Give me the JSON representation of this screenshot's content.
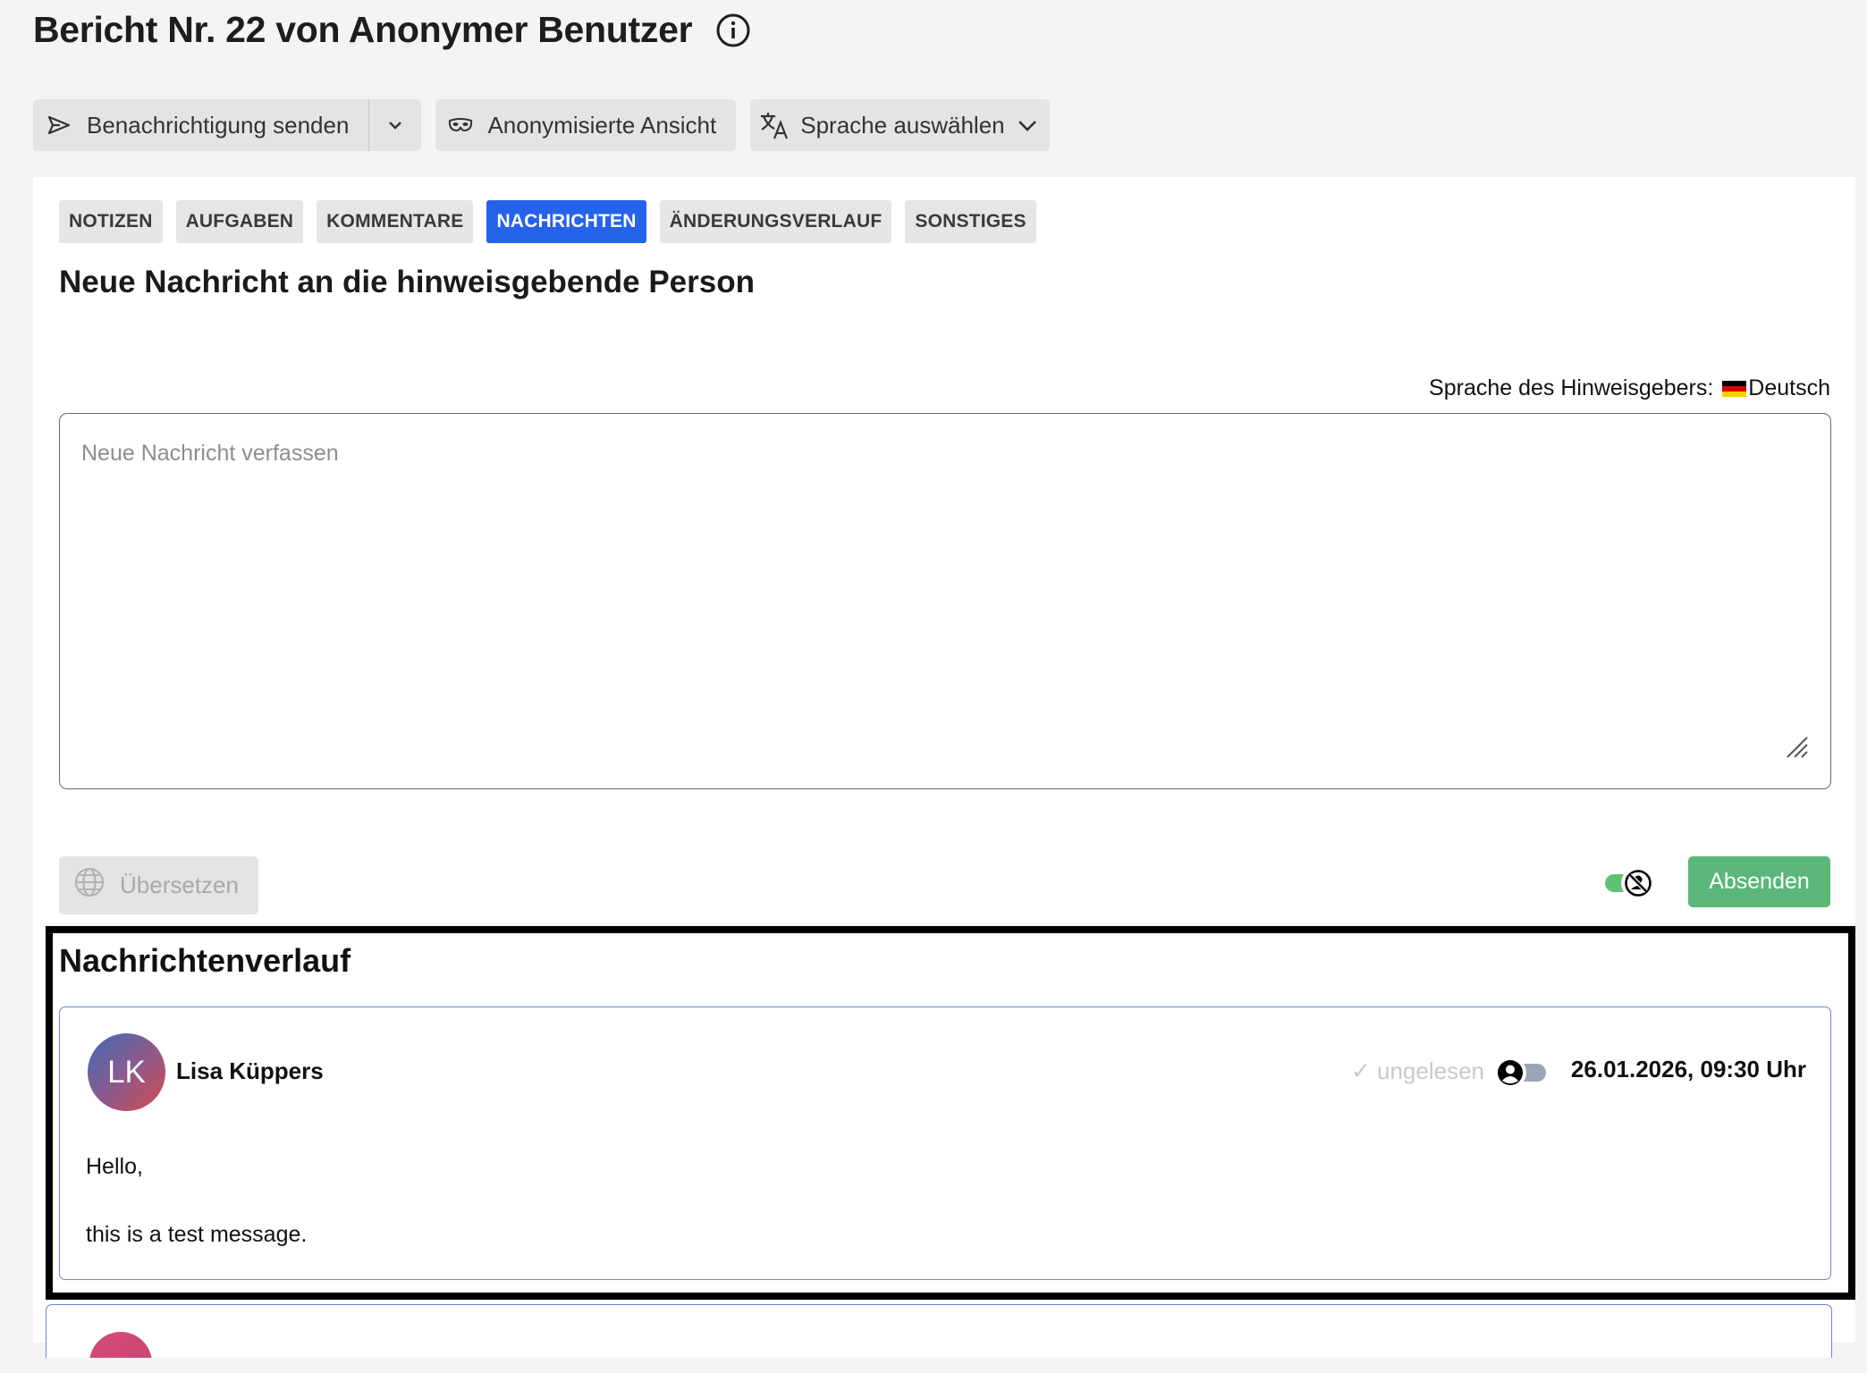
{
  "page": {
    "title": "Bericht Nr. 22 von Anonymer Benutzer"
  },
  "toolbar": {
    "notify_label": "Benachrichtigung senden",
    "anonymized_label": "Anonymisierte Ansicht",
    "language_label": "Sprache auswählen"
  },
  "tabs": [
    {
      "label": "NOTIZEN",
      "active": false
    },
    {
      "label": "AUFGABEN",
      "active": false
    },
    {
      "label": "KOMMENTARE",
      "active": false
    },
    {
      "label": "NACHRICHTEN",
      "active": true
    },
    {
      "label": "ÄNDERUNGSVERLAUF",
      "active": false
    },
    {
      "label": "SONSTIGES",
      "active": false
    }
  ],
  "compose": {
    "title": "Neue Nachricht an die hinweisgebende Person",
    "reporter_language_label": "Sprache des Hinweisgebers:",
    "reporter_language_value": "Deutsch",
    "placeholder": "Neue Nachricht verfassen",
    "value": "",
    "translate_label": "Übersetzen",
    "send_label": "Absenden"
  },
  "history": {
    "title": "Nachrichtenverlauf",
    "messages": [
      {
        "initials": "LK",
        "author": "Lisa Küppers",
        "read_status": "✓ ungelesen",
        "timestamp": "26.01.2026, 09:30 Uhr",
        "line1": "Hello,",
        "line2": "this is a test message."
      }
    ]
  },
  "colors": {
    "accent": "#2563eb",
    "send_button": "#5ab779",
    "toggle_on": "#5ec176",
    "card_border": "#6d87d8",
    "unread_text": "#c9c9c9"
  },
  "icons": {
    "info": "info-circle-icon",
    "send": "send-icon",
    "caret": "chevron-down-icon",
    "mask": "mask-icon",
    "translate": "translate-icon",
    "globe": "globe-icon",
    "flag": "germany-flag-icon",
    "resize": "resize-grip-icon",
    "visibility": "eye-off-icon",
    "user": "user-icon"
  }
}
